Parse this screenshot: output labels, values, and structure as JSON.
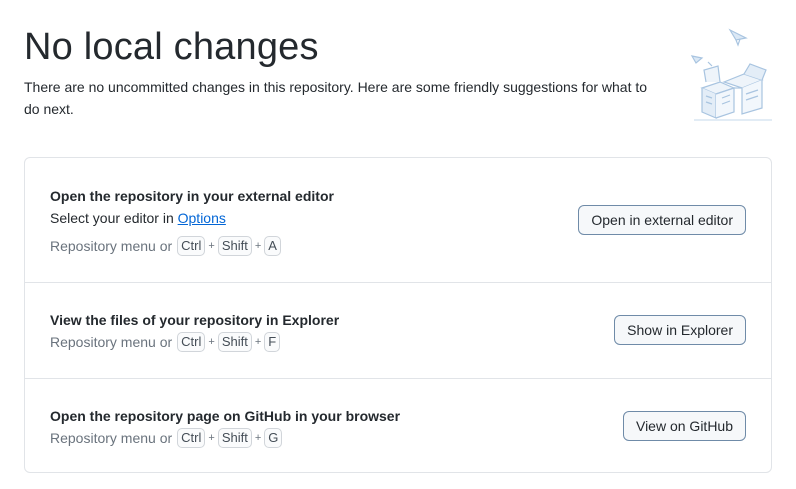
{
  "header": {
    "title": "No local changes",
    "subtitle": "There are no uncommitted changes in this repository. Here are some friendly suggestions for what to do next."
  },
  "suggestions": [
    {
      "title": "Open the repository in your external editor",
      "text_prefix": "Select your editor in ",
      "link_label": "Options",
      "shortcut_prefix": "Repository menu or",
      "keys": [
        "Ctrl",
        "Shift",
        "A"
      ],
      "button_label": "Open in external editor"
    },
    {
      "title": "View the files of your repository in Explorer",
      "shortcut_prefix": "Repository menu or",
      "keys": [
        "Ctrl",
        "Shift",
        "F"
      ],
      "button_label": "Show in Explorer"
    },
    {
      "title": "Open the repository page on GitHub in your browser",
      "shortcut_prefix": "Repository menu or",
      "keys": [
        "Ctrl",
        "Shift",
        "G"
      ],
      "button_label": "View on GitHub"
    }
  ],
  "key_separator": "+",
  "illustration_icon": "empty-boxes-illustration-icon",
  "colors": {
    "link": "#0366d6",
    "border": "#e1e4e8",
    "button_border": "#6f8ba8",
    "muted_text": "#6a737d",
    "illustration": "#a8c4e0"
  }
}
